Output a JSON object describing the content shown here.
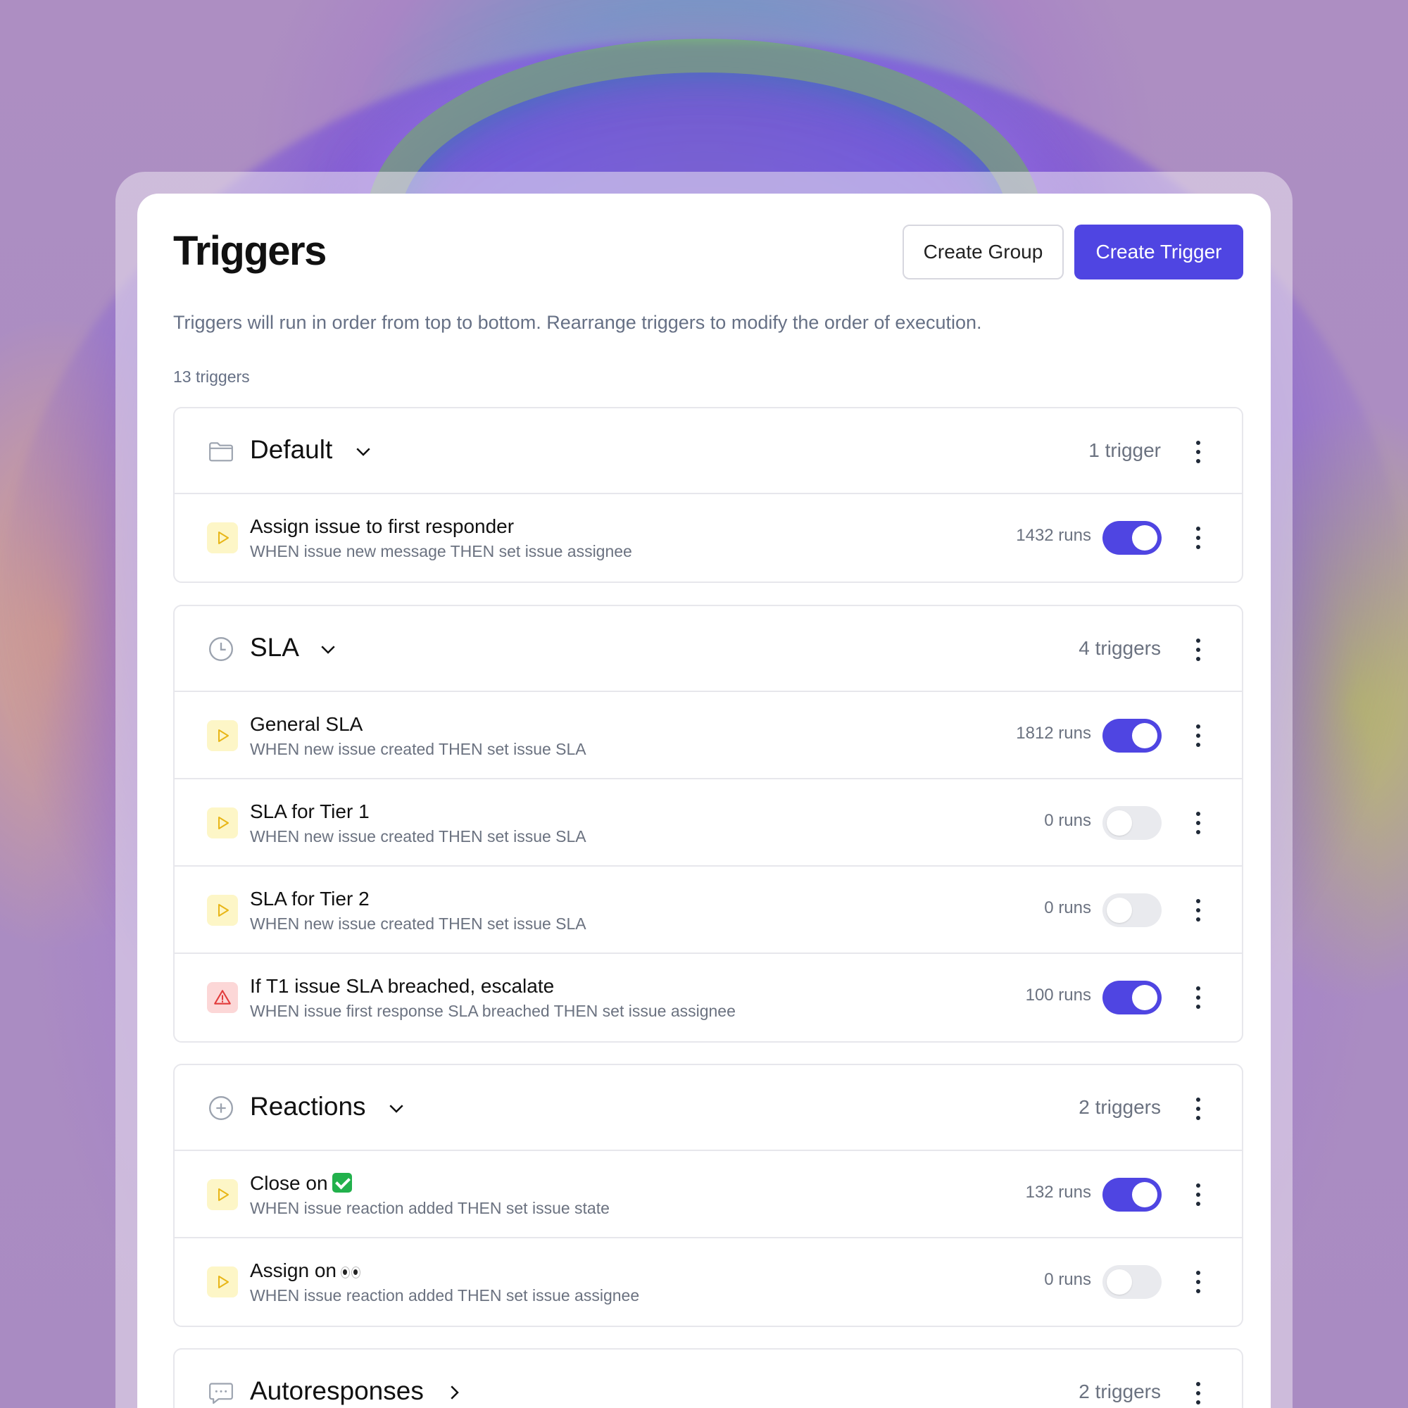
{
  "page": {
    "title": "Triggers",
    "description": "Triggers will run in order from top to bottom. Rearrange triggers to modify the order of execution.",
    "count": "13 triggers"
  },
  "buttons": {
    "create_group": "Create Group",
    "create_trigger": "Create Trigger"
  },
  "colors": {
    "accent": "#4f45e2",
    "trigger_icon_bg": "#fdf6c7",
    "warning_icon_bg": "#fcd7d7"
  },
  "groups": [
    {
      "name": "Default",
      "icon": "folder-icon",
      "expanded": true,
      "count": "1 trigger",
      "triggers": [
        {
          "title": "Assign issue to first responder",
          "subtitle": "WHEN issue new message THEN set issue assignee",
          "runs": "1432 runs",
          "enabled": true,
          "icon": "play-icon"
        }
      ]
    },
    {
      "name": "SLA",
      "icon": "clock-icon",
      "expanded": true,
      "count": "4 triggers",
      "triggers": [
        {
          "title": "General SLA",
          "subtitle": "WHEN new issue created THEN set issue SLA",
          "runs": "1812 runs",
          "enabled": true,
          "icon": "play-icon"
        },
        {
          "title": "SLA for Tier 1",
          "subtitle": "WHEN new issue created THEN set issue SLA",
          "runs": "0 runs",
          "enabled": false,
          "icon": "play-icon"
        },
        {
          "title": "SLA for Tier 2",
          "subtitle": "WHEN new issue created THEN set issue SLA",
          "runs": "0 runs",
          "enabled": false,
          "icon": "play-icon"
        },
        {
          "title": "If T1 issue SLA breached, escalate",
          "subtitle": "WHEN issue first response SLA breached THEN set issue assignee",
          "runs": "100 runs",
          "enabled": true,
          "icon": "warning-icon"
        }
      ]
    },
    {
      "name": "Reactions",
      "icon": "plus-circle-icon",
      "expanded": true,
      "count": "2 triggers",
      "triggers": [
        {
          "title": "Close on",
          "title_emoji": "check-mark-emoji",
          "subtitle": "WHEN issue reaction added THEN set issue state",
          "runs": "132 runs",
          "enabled": true,
          "icon": "play-icon"
        },
        {
          "title": "Assign on",
          "title_emoji": "eyes-emoji",
          "subtitle": "WHEN issue reaction added THEN set issue assignee",
          "runs": "0 runs",
          "enabled": false,
          "icon": "play-icon"
        }
      ]
    },
    {
      "name": "Autoresponses",
      "icon": "chat-bubble-icon",
      "expanded": false,
      "count": "2 triggers",
      "triggers": []
    }
  ]
}
